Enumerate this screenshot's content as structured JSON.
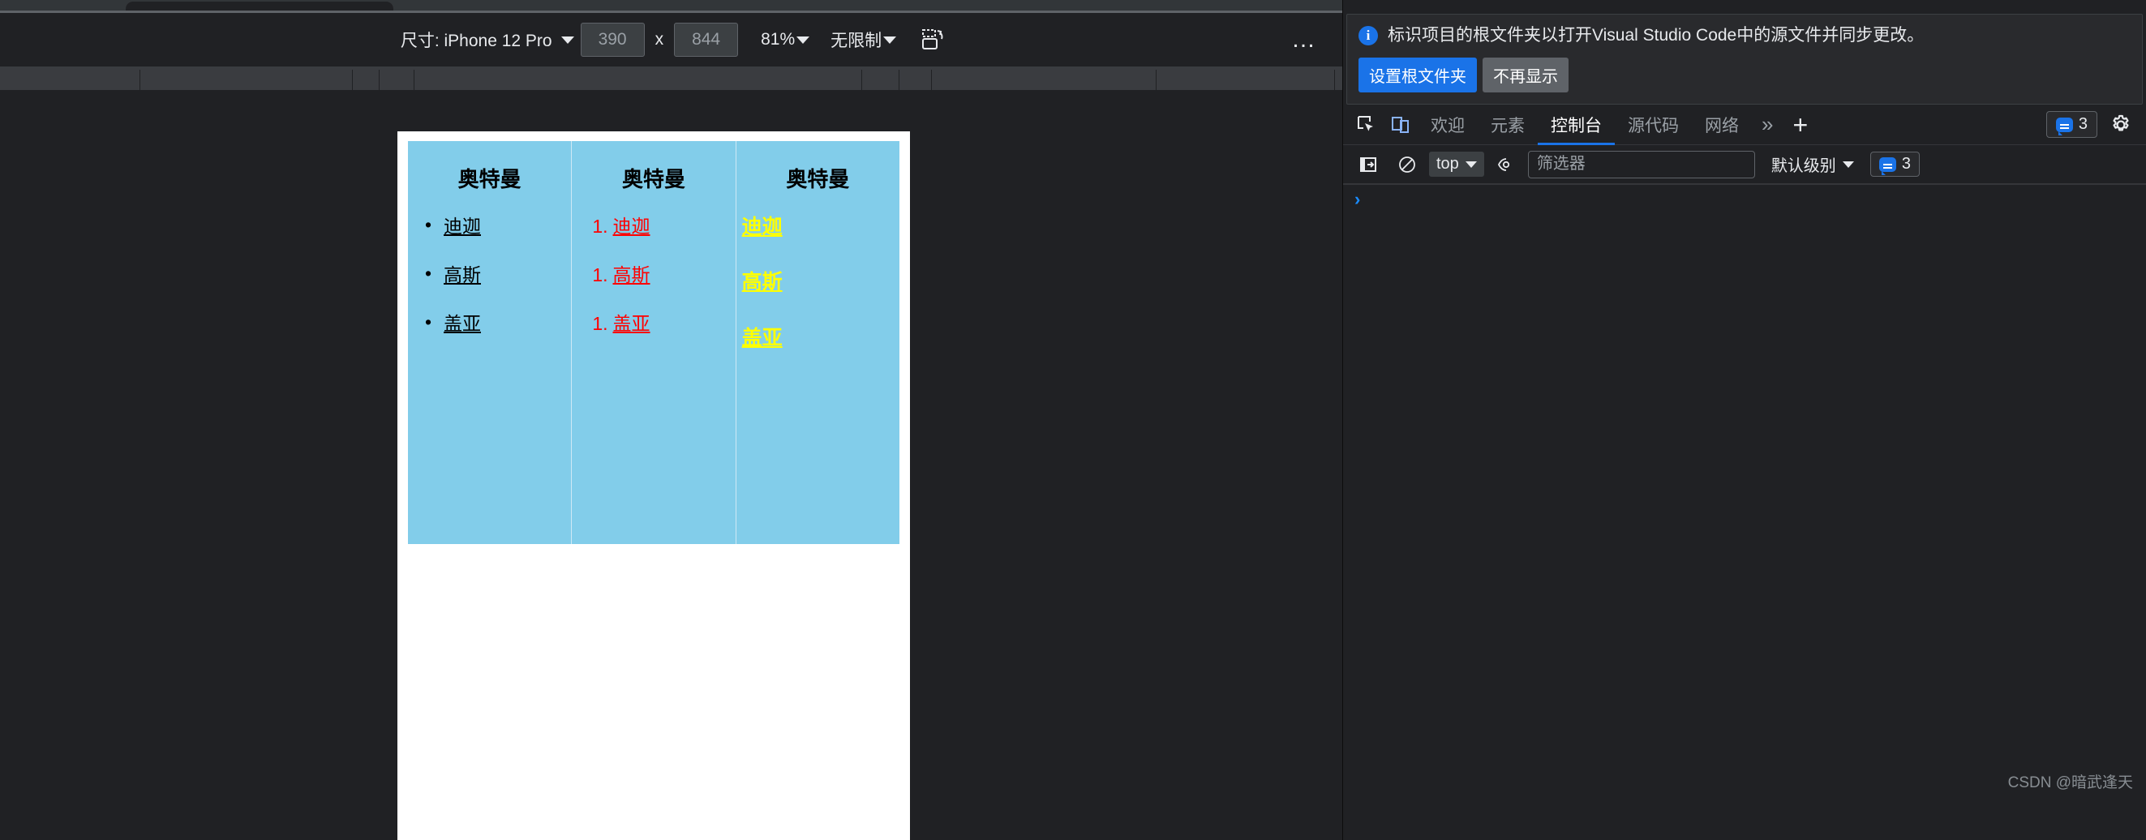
{
  "device_toolbar": {
    "size_label": "尺寸: iPhone 12 Pro",
    "width_value": "390",
    "height_value": "844",
    "dim_separator": "x",
    "zoom_label": "81%",
    "throttle_label": "无限制",
    "rotate_icon": "rotate-device-icon",
    "more_label": "…"
  },
  "page_content": {
    "columns": [
      {
        "title": "奥特曼",
        "style": "bullet-black",
        "items": [
          {
            "marker": "•",
            "text": "迪迦"
          },
          {
            "marker": "•",
            "text": "高斯"
          },
          {
            "marker": "•",
            "text": "盖亚"
          }
        ]
      },
      {
        "title": "奥特曼",
        "style": "numbered-red",
        "items": [
          {
            "marker": "1.",
            "text": "迪迦"
          },
          {
            "marker": "1.",
            "text": "高斯"
          },
          {
            "marker": "1.",
            "text": "盖亚"
          }
        ]
      },
      {
        "title": "奥特曼",
        "style": "plain-yellow",
        "items": [
          {
            "marker": "",
            "text": "迪迦"
          },
          {
            "marker": "",
            "text": "高斯"
          },
          {
            "marker": "",
            "text": "盖亚"
          }
        ]
      }
    ],
    "colors": {
      "box_background": "#82cdea",
      "divider": "#cfe9f5",
      "title_color": "#000000",
      "bullet_text_color": "#000000",
      "numbered_text_color": "#ff0000",
      "plain_text_color": "#ffff00",
      "page_background": "#ffffff"
    }
  },
  "devtools": {
    "infobar": {
      "icon": "info-icon",
      "message": "标识项目的根文件夹以打开Visual Studio Code中的源文件并同步更改。",
      "primary_button": "设置根文件夹",
      "secondary_button": "不再显示"
    },
    "tabs": {
      "inspect_icon": "inspect-element-icon",
      "device_icon": "device-toggle-icon",
      "items": [
        {
          "label": "欢迎",
          "active": false
        },
        {
          "label": "元素",
          "active": false
        },
        {
          "label": "控制台",
          "active": true
        },
        {
          "label": "源代码",
          "active": false
        },
        {
          "label": "网络",
          "active": false
        }
      ],
      "overflow_label": "»",
      "add_label": "+",
      "message_count": "3",
      "settings_icon": "gear-icon"
    },
    "console_toolbar": {
      "sidebar_icon": "console-sidebar-icon",
      "clear_icon": "clear-console-icon",
      "context_value": "top",
      "eye_icon": "live-expression-icon",
      "filter_placeholder": "筛选器",
      "filter_value": "",
      "level_label": "默认级别",
      "message_count": "3"
    },
    "console_body": {
      "prompt": "›"
    },
    "colors": {
      "accent": "#1a73e8",
      "panel_background": "#202124",
      "text": "#e8eaed",
      "muted_text": "#9aa0a6"
    }
  },
  "watermark": "CSDN @暗武逢天"
}
